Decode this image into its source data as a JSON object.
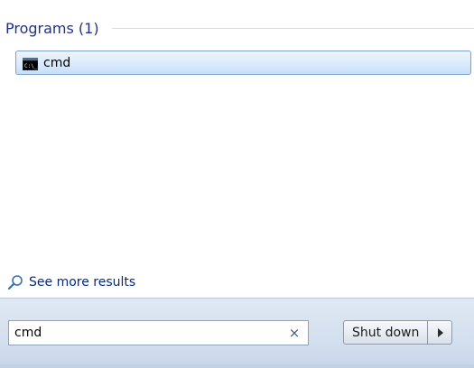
{
  "results": {
    "group_title": "Programs (1)",
    "items": [
      {
        "label": "cmd",
        "icon": "command-prompt-icon"
      }
    ],
    "see_more_label": "See more results",
    "see_more_icon": "search-icon"
  },
  "search": {
    "value": "cmd",
    "clear_icon": "clear-search-icon",
    "clear_glyph": "×"
  },
  "shutdown": {
    "label": "Shut down",
    "options_icon": "arrow-right-icon"
  },
  "colors": {
    "group_title": "#1e3287",
    "selection_border": "#7da2ce",
    "bottom_bar": "#d4dfee"
  }
}
